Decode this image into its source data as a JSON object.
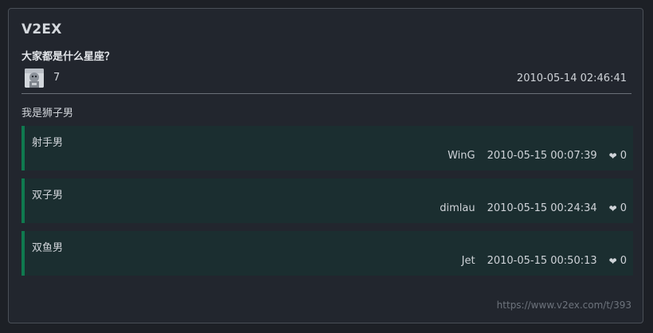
{
  "site": {
    "name": "V2EX"
  },
  "topic": {
    "title": "大家都是什么星座？",
    "reply_count": "7",
    "time": "2010-05-14 02:46:41",
    "content": "我是狮子男"
  },
  "replies": [
    {
      "text": "射手男",
      "author": "WinG",
      "time": "2010-05-15 00:07:39",
      "likes": "0"
    },
    {
      "text": "双子男",
      "author": "dimlau",
      "time": "2010-05-15 00:24:34",
      "likes": "0"
    },
    {
      "text": "双鱼男",
      "author": "Jet",
      "time": "2010-05-15 00:50:13",
      "likes": "0"
    }
  ],
  "footer": {
    "url": "https://www.v2ex.com/t/393"
  },
  "icons": {
    "like": "heart-icon",
    "avatar": "avatar-image"
  },
  "colors": {
    "accent": "#0f7a4f",
    "reply_bg": "#1b2e30",
    "card_bg": "#22262e"
  }
}
